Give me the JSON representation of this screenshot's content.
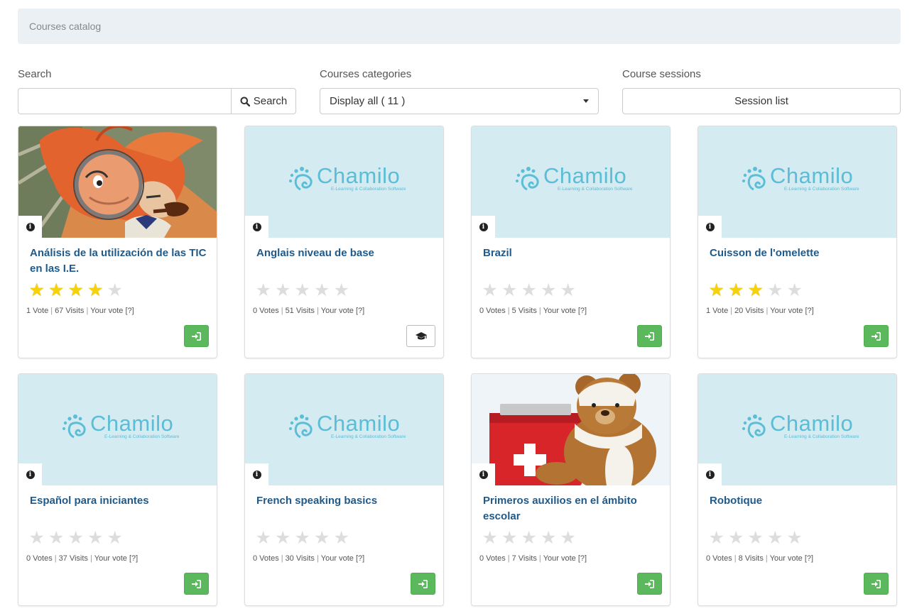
{
  "breadcrumb": "Courses catalog",
  "filters": {
    "search_label": "Search",
    "search_value": "",
    "search_button": "Search",
    "categories_label": "Courses categories",
    "categories_selected": "Display all ( 11 )",
    "sessions_label": "Course sessions",
    "sessions_button": "Session list"
  },
  "rating_legend": {
    "sep": "|"
  },
  "courses": [
    {
      "title": "Análisis de la utilización de las TIC en las I.E.",
      "rating": 4,
      "votes": "1 Vote",
      "visits": "67 Visits",
      "your_vote": "Your vote",
      "help": "[?]",
      "image": "detective",
      "action": "enter"
    },
    {
      "title": "Anglais niveau de base",
      "rating": 0,
      "votes": "0 Votes",
      "visits": "51 Visits",
      "your_vote": "Your vote",
      "help": "[?]",
      "image": "chamilo-logo",
      "action": "subscribe"
    },
    {
      "title": "Brazil",
      "rating": 0,
      "votes": "0 Votes",
      "visits": "5 Visits",
      "your_vote": "Your vote",
      "help": "[?]",
      "image": "chamilo-logo",
      "action": "enter"
    },
    {
      "title": "Cuisson de l'omelette",
      "rating": 3,
      "votes": "1 Vote",
      "visits": "20 Visits",
      "your_vote": "Your vote",
      "help": "[?]",
      "image": "chamilo-logo",
      "action": "enter"
    },
    {
      "title": "Español para iniciantes",
      "rating": 0,
      "votes": "0 Votes",
      "visits": "37 Visits",
      "your_vote": "Your vote",
      "help": "[?]",
      "image": "chamilo-logo",
      "action": "enter"
    },
    {
      "title": "French speaking basics",
      "rating": 0,
      "votes": "0 Votes",
      "visits": "30 Visits",
      "your_vote": "Your vote",
      "help": "[?]",
      "image": "chamilo-logo",
      "action": "enter"
    },
    {
      "title": "Primeros auxilios en el ámbito escolar",
      "rating": 0,
      "votes": "0 Votes",
      "visits": "7 Visits",
      "your_vote": "Your vote",
      "help": "[?]",
      "image": "teddy-first-aid",
      "action": "enter"
    },
    {
      "title": "Robotique",
      "rating": 0,
      "votes": "0 Votes",
      "visits": "8 Visits",
      "your_vote": "Your vote",
      "help": "[?]",
      "image": "chamilo-logo",
      "action": "enter"
    }
  ],
  "logo": {
    "name": "Chamilo",
    "tagline": "E-Learning & Collaboration Software"
  },
  "colors": {
    "accent": "#1f5a8a",
    "success": "#5cb85c",
    "star_on": "#f5d20a",
    "star_off": "#dddddd",
    "logo": "#5bbdd6"
  }
}
